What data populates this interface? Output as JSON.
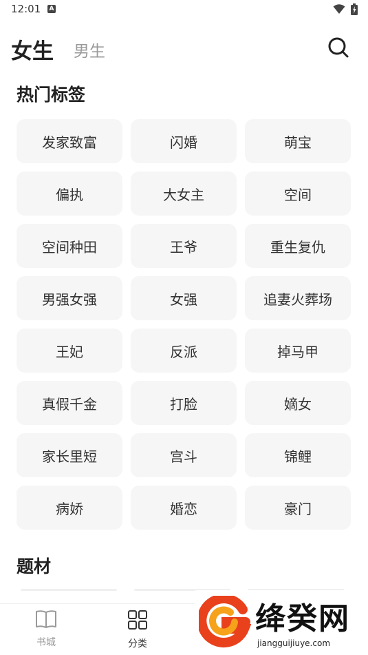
{
  "status_bar": {
    "time": "12:01",
    "notification_icon": "a-icon"
  },
  "header": {
    "tabs": [
      {
        "label": "女生",
        "active": true
      },
      {
        "label": "男生",
        "active": false
      }
    ],
    "search_icon": "search-icon"
  },
  "hot_tags": {
    "title": "热门标签",
    "tags": [
      "发家致富",
      "闪婚",
      "萌宝",
      "偏执",
      "大女主",
      "空间",
      "空间种田",
      "王爷",
      "重生复仇",
      "男强女强",
      "女强",
      "追妻火葬场",
      "王妃",
      "反派",
      "掉马甲",
      "真假千金",
      "打脸",
      "嫡女",
      "家长里短",
      "宫斗",
      "锦鲤",
      "病娇",
      "婚恋",
      "豪门"
    ]
  },
  "topics": {
    "title": "题材"
  },
  "bottom_nav": {
    "items": [
      {
        "label": "书城",
        "icon": "book-icon",
        "active": false
      },
      {
        "label": "分类",
        "icon": "grid-icon",
        "active": true
      }
    ]
  },
  "watermark": {
    "text": "绛癸网",
    "url": "jiangguijiuye.com"
  },
  "colors": {
    "tag_bg": "#f6f6f6",
    "inactive_text": "#9a9a9a",
    "primary_text": "#222222"
  }
}
